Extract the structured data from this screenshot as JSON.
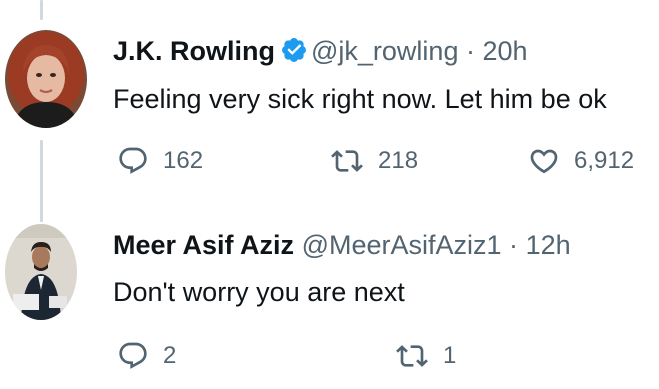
{
  "tweets": [
    {
      "display_name": "J.K. Rowling",
      "handle": "@jk_rowling",
      "separator": "·",
      "time": "20h",
      "verified": true,
      "text": "Feeling very sick right now. Let him be ok",
      "reply_count": "162",
      "retweet_count": "218",
      "like_count": "6,912"
    },
    {
      "display_name": "Meer Asif Aziz",
      "handle": "@MeerAsifAziz1",
      "separator": "·",
      "time": "12h",
      "verified": false,
      "text": "Don't worry you are next",
      "reply_count": "2",
      "retweet_count": "1"
    }
  ],
  "icons": {
    "verified": "verified-badge-icon",
    "reply": "reply-icon",
    "retweet": "retweet-icon",
    "like": "heart-icon"
  },
  "colors": {
    "verified": "#1d9bf0",
    "text": "#0f1419",
    "secondary": "#536471",
    "thread_line": "#cfd9de"
  }
}
